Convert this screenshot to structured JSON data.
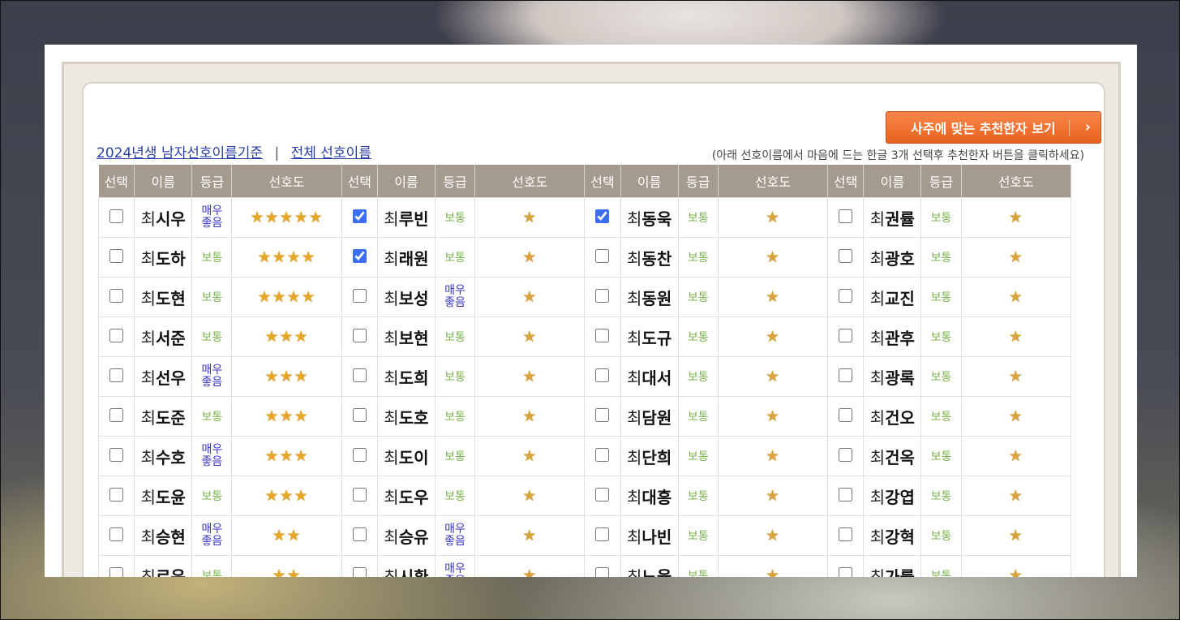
{
  "recommend_button": {
    "label": "사주에 맞는 추천한자 보기",
    "chevron": "›"
  },
  "nav": {
    "link_2024": "2024년생 남자선호이름기준",
    "divider": "|",
    "link_all": "전체 선호이름"
  },
  "hint": "(아래 선호이름에서 마음에 드는 한글 3개 선택후 추천한자 버튼을 클릭하세요)",
  "headers": [
    "선택",
    "이름",
    "등급",
    "선호도"
  ],
  "surname": "최",
  "star_char": "★",
  "colors": {
    "button": "#e8621f",
    "header_bg": "#a49a8e",
    "grade_normal": "#7bb54f",
    "grade_top": "#3633c4",
    "star": "#e6a729"
  },
  "rows": [
    [
      {
        "name": "시우",
        "checked": false,
        "grade": "매우 좋음",
        "stars": 5
      },
      {
        "name": "루빈",
        "checked": true,
        "grade": "보통",
        "stars": 1
      },
      {
        "name": "동욱",
        "checked": true,
        "grade": "보통",
        "stars": 1
      },
      {
        "name": "권률",
        "checked": false,
        "grade": "보통",
        "stars": 1
      }
    ],
    [
      {
        "name": "도하",
        "checked": false,
        "grade": "보통",
        "stars": 4
      },
      {
        "name": "래원",
        "checked": true,
        "grade": "보통",
        "stars": 1
      },
      {
        "name": "동찬",
        "checked": false,
        "grade": "보통",
        "stars": 1
      },
      {
        "name": "광호",
        "checked": false,
        "grade": "보통",
        "stars": 1
      }
    ],
    [
      {
        "name": "도현",
        "checked": false,
        "grade": "보통",
        "stars": 4
      },
      {
        "name": "보성",
        "checked": false,
        "grade": "매우 좋음",
        "stars": 1
      },
      {
        "name": "동원",
        "checked": false,
        "grade": "보통",
        "stars": 1
      },
      {
        "name": "교진",
        "checked": false,
        "grade": "보통",
        "stars": 1
      }
    ],
    [
      {
        "name": "서준",
        "checked": false,
        "grade": "보통",
        "stars": 3
      },
      {
        "name": "보현",
        "checked": false,
        "grade": "보통",
        "stars": 1
      },
      {
        "name": "도규",
        "checked": false,
        "grade": "보통",
        "stars": 1
      },
      {
        "name": "관후",
        "checked": false,
        "grade": "보통",
        "stars": 1
      }
    ],
    [
      {
        "name": "선우",
        "checked": false,
        "grade": "매우 좋음",
        "stars": 3
      },
      {
        "name": "도희",
        "checked": false,
        "grade": "보통",
        "stars": 1
      },
      {
        "name": "대서",
        "checked": false,
        "grade": "보통",
        "stars": 1
      },
      {
        "name": "광록",
        "checked": false,
        "grade": "보통",
        "stars": 1
      }
    ],
    [
      {
        "name": "도준",
        "checked": false,
        "grade": "보통",
        "stars": 3
      },
      {
        "name": "도호",
        "checked": false,
        "grade": "보통",
        "stars": 1
      },
      {
        "name": "담원",
        "checked": false,
        "grade": "보통",
        "stars": 1
      },
      {
        "name": "건오",
        "checked": false,
        "grade": "보통",
        "stars": 1
      }
    ],
    [
      {
        "name": "수호",
        "checked": false,
        "grade": "매우 좋음",
        "stars": 3
      },
      {
        "name": "도이",
        "checked": false,
        "grade": "보통",
        "stars": 1
      },
      {
        "name": "단희",
        "checked": false,
        "grade": "보통",
        "stars": 1
      },
      {
        "name": "건옥",
        "checked": false,
        "grade": "보통",
        "stars": 1
      }
    ],
    [
      {
        "name": "도윤",
        "checked": false,
        "grade": "보통",
        "stars": 3
      },
      {
        "name": "도우",
        "checked": false,
        "grade": "보통",
        "stars": 1
      },
      {
        "name": "대흥",
        "checked": false,
        "grade": "보통",
        "stars": 1
      },
      {
        "name": "강엽",
        "checked": false,
        "grade": "보통",
        "stars": 1
      }
    ],
    [
      {
        "name": "승현",
        "checked": false,
        "grade": "매우 좋음",
        "stars": 2
      },
      {
        "name": "승유",
        "checked": false,
        "grade": "매우 좋음",
        "stars": 1
      },
      {
        "name": "나빈",
        "checked": false,
        "grade": "보통",
        "stars": 1
      },
      {
        "name": "강혁",
        "checked": false,
        "grade": "보통",
        "stars": 1
      }
    ],
    [
      {
        "name": "로윤",
        "checked": false,
        "grade": "보통",
        "stars": 2
      },
      {
        "name": "시환",
        "checked": false,
        "grade": "매우 좋음",
        "stars": 1
      },
      {
        "name": "노율",
        "checked": false,
        "grade": "보통",
        "stars": 1
      },
      {
        "name": "가률",
        "checked": false,
        "grade": "보통",
        "stars": 1
      }
    ]
  ]
}
